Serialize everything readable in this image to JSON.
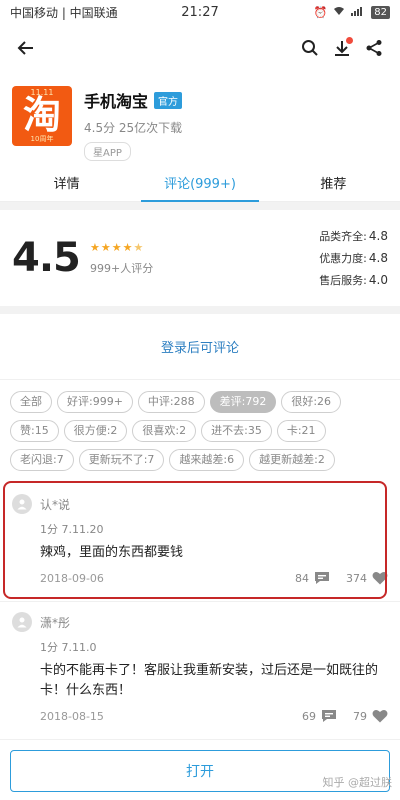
{
  "status_bar": {
    "carriers": "中国移动 | 中国联通",
    "time": "21:27",
    "battery": "82"
  },
  "app": {
    "name": "手机淘宝",
    "official_badge": "官方",
    "meta": "4.5分  25亿次下载",
    "chip": "星APP",
    "logo_glyph": "淘",
    "logo_top": "11.11",
    "logo_bottom": "10周年"
  },
  "tabs": [
    {
      "label": "详情"
    },
    {
      "label": "评论(999+)"
    },
    {
      "label": "推荐"
    }
  ],
  "rating": {
    "score": "4.5",
    "stars": 4.5,
    "count": "999+人评分",
    "subs": [
      {
        "label": "品类齐全:",
        "value": "4.8"
      },
      {
        "label": "优惠力度:",
        "value": "4.8"
      },
      {
        "label": "售后服务:",
        "value": "4.0"
      }
    ]
  },
  "login_prompt": "登录后可评论",
  "filters": [
    {
      "label": "全部"
    },
    {
      "label": "好评:999+"
    },
    {
      "label": "中评:288"
    },
    {
      "label": "差评:792"
    },
    {
      "label": "很好:26"
    },
    {
      "label": "赞:15"
    },
    {
      "label": "很方便:2"
    },
    {
      "label": "很喜欢:2"
    },
    {
      "label": "进不去:35"
    },
    {
      "label": "卡:21"
    },
    {
      "label": "老闪退:7"
    },
    {
      "label": "更新玩不了:7"
    },
    {
      "label": "越来越差:6"
    },
    {
      "label": "越更新越差:2"
    }
  ],
  "comments": [
    {
      "user": "认*说",
      "rating_version": "1分  7.11.20",
      "text": "辣鸡，里面的东西都要钱",
      "date": "2018-09-06",
      "replies": "84",
      "likes": "374"
    },
    {
      "user": "潇*彤",
      "rating_version": "1分  7.11.0",
      "text": "卡的不能再卡了！客服让我重新安装，过后还是一如既往的卡！什么东西！",
      "date": "2018-08-15",
      "replies": "69",
      "likes": "79"
    }
  ],
  "open_button": "打开",
  "watermark": "知乎 @超过朕"
}
